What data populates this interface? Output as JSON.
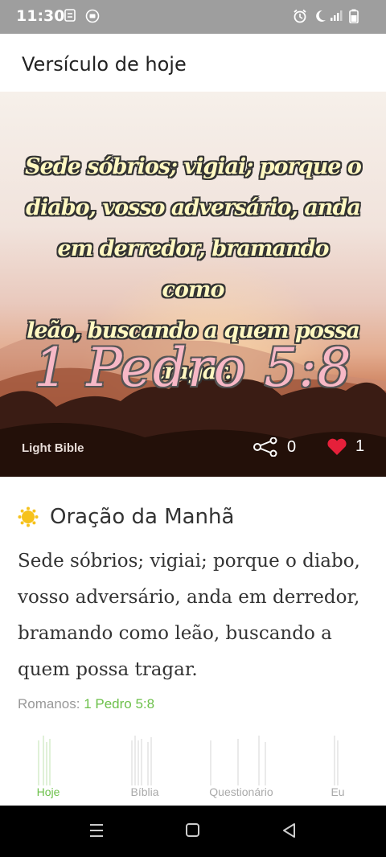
{
  "status": {
    "time": "11:30"
  },
  "header": {
    "title": "Versículo de hoje"
  },
  "hero": {
    "verse_lines": [
      "Sede sóbrios; vigiai; porque o",
      "diabo, vosso adversário, anda",
      "em derredor, bramando como",
      "leão, buscando a quem possa",
      "tragar."
    ],
    "reference": "1 Pedro 5:8",
    "brand": "Light Bible",
    "share_count": "0",
    "like_count": "1"
  },
  "prayer": {
    "title": "Oração da Manhã",
    "text": "Sede sóbrios; vigiai; porque o diabo, vosso adversário, anda em derredor, bramando como leão, buscando a quem possa tragar.",
    "source_prefix": "Romanos: ",
    "source_ref": "1 Pedro 5:8"
  },
  "tabs": [
    {
      "label": "Hoje",
      "active": true
    },
    {
      "label": "Bíblia",
      "active": false
    },
    {
      "label": "Questionário",
      "active": false
    },
    {
      "label": "Eu",
      "active": false
    }
  ],
  "colors": {
    "accent": "#6cc04a",
    "heart": "#e5203a"
  }
}
